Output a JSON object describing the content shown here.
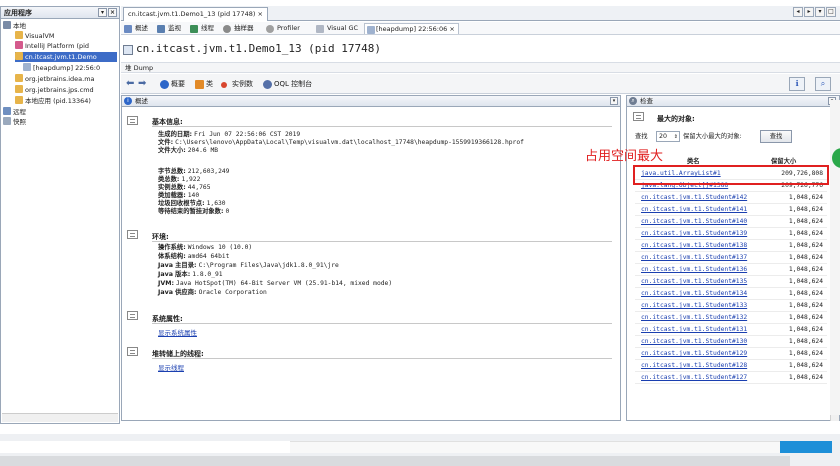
{
  "left_panel": {
    "title": "应用程序",
    "tree": [
      {
        "label": "本地",
        "icon": "computer-icon"
      },
      {
        "label": "VisualVM",
        "icon": "java-icon"
      },
      {
        "label": "IntelliJ Platform (pid",
        "icon": "intellij-icon"
      },
      {
        "label": "cn.itcast.jvm.t1.Demo",
        "icon": "java-icon"
      },
      {
        "label": "[heapdump] 22:56:0",
        "icon": "heapdump-icon"
      },
      {
        "label": "org.jetbrains.idea.ma",
        "icon": "java-icon"
      },
      {
        "label": "org.jetbrains.jps.cmd",
        "icon": "java-icon"
      },
      {
        "label": "本地应用 (pid.13364)",
        "icon": "java-icon"
      },
      {
        "label": "远程",
        "icon": "remote-icon"
      },
      {
        "label": "快照",
        "icon": "snapshot-icon"
      }
    ]
  },
  "tabs": {
    "document_tab": "cn.itcast.jvm.t1.Demo1_13 (pid 17748)",
    "sub_tabs": [
      "概述",
      "监视",
      "线程",
      "抽样器",
      "Profiler",
      "Visual GC",
      "[heapdump] 22:56:06"
    ]
  },
  "title": "cn.itcast.jvm.t1.Demo1_13 (pid 17748)",
  "heap_bar_label": "堆 Dump",
  "toolbar": {
    "items": [
      "概要",
      "类",
      "实例数",
      "OQL 控制台"
    ]
  },
  "summary": {
    "header": "概述",
    "basic_title": "基本信息:",
    "basic": [
      {
        "k": "生成的日期:",
        "v": "Fri Jun 07 22:56:06 CST 2019"
      },
      {
        "k": "文件:",
        "v": "C:\\Users\\lenovo\\AppData\\Local\\Temp\\visualvm.dat\\localhost_17748\\heapdump-1559919366128.hprof"
      },
      {
        "k": "文件大小:",
        "v": "204.6 MB"
      }
    ],
    "stats": [
      {
        "k": "字节总数:",
        "v": "212,603,249"
      },
      {
        "k": "类总数:",
        "v": "1,922"
      },
      {
        "k": "实例总数:",
        "v": "44,765"
      },
      {
        "k": "类加载器:",
        "v": "140"
      },
      {
        "k": "垃圾回收根节点:",
        "v": "1,630"
      },
      {
        "k": "等待结束的暂挂对象数:",
        "v": "0"
      }
    ],
    "env_title": "环境:",
    "env": [
      {
        "k": "操作系统:",
        "v": "Windows 10 (10.0)"
      },
      {
        "k": "体系结构:",
        "v": "amd64 64bit"
      },
      {
        "k": "Java 主目录:",
        "v": "C:\\Program Files\\Java\\jdk1.8.0_91\\jre"
      },
      {
        "k": "Java 版本:",
        "v": "1.8.0_91"
      },
      {
        "k": "JVM:",
        "v": "Java HotSpot(TM) 64-Bit Server VM (25.91-b14, mixed mode)"
      },
      {
        "k": "Java 供应商:",
        "v": "Oracle Corporation"
      }
    ],
    "sysprops_title": "系统属性:",
    "sysprops_link": "显示系统属性",
    "threads_title": "堆转储上的线程:",
    "threads_link": "显示线程"
  },
  "inspect": {
    "header": "检查",
    "section_title": "最大的对象:",
    "find_label": "查找",
    "find_count": "20",
    "keep_label": "保留大小最大的对象:",
    "find_button": "查找",
    "col_class": "类名",
    "col_size": "保留大小",
    "rows": [
      {
        "name": "java.util.ArrayList#1",
        "size": "209,726,808"
      },
      {
        "name": "java.lang.Object[]#1388",
        "size": "209,726,776"
      },
      {
        "name": "cn.itcast.jvm.t1.Student#142",
        "size": "1,048,624"
      },
      {
        "name": "cn.itcast.jvm.t1.Student#141",
        "size": "1,048,624"
      },
      {
        "name": "cn.itcast.jvm.t1.Student#140",
        "size": "1,048,624"
      },
      {
        "name": "cn.itcast.jvm.t1.Student#139",
        "size": "1,048,624"
      },
      {
        "name": "cn.itcast.jvm.t1.Student#138",
        "size": "1,048,624"
      },
      {
        "name": "cn.itcast.jvm.t1.Student#137",
        "size": "1,048,624"
      },
      {
        "name": "cn.itcast.jvm.t1.Student#136",
        "size": "1,048,624"
      },
      {
        "name": "cn.itcast.jvm.t1.Student#135",
        "size": "1,048,624"
      },
      {
        "name": "cn.itcast.jvm.t1.Student#134",
        "size": "1,048,624"
      },
      {
        "name": "cn.itcast.jvm.t1.Student#133",
        "size": "1,048,624"
      },
      {
        "name": "cn.itcast.jvm.t1.Student#132",
        "size": "1,048,624"
      },
      {
        "name": "cn.itcast.jvm.t1.Student#131",
        "size": "1,048,624"
      },
      {
        "name": "cn.itcast.jvm.t1.Student#130",
        "size": "1,048,624"
      },
      {
        "name": "cn.itcast.jvm.t1.Student#129",
        "size": "1,048,624"
      },
      {
        "name": "cn.itcast.jvm.t1.Student#128",
        "size": "1,048,624"
      },
      {
        "name": "cn.itcast.jvm.t1.Student#127",
        "size": "1,048,624"
      }
    ]
  },
  "annotation": "占用空间最大",
  "colors": {
    "accent": "#3d6cc7",
    "link": "#1a3fb0",
    "highlight": "#e02020",
    "taskbar": "#1d8fd8"
  }
}
